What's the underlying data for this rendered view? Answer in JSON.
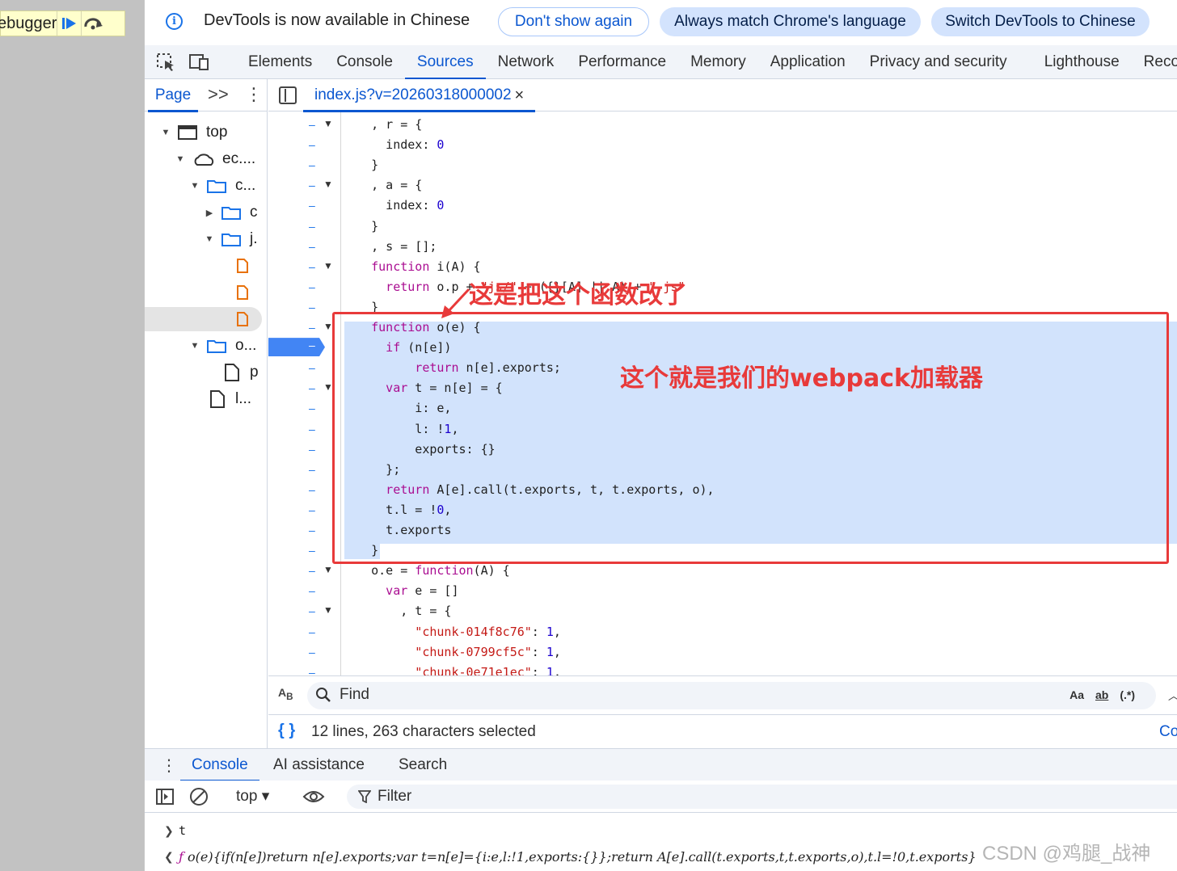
{
  "paused": {
    "label": "ebugger"
  },
  "infobar": {
    "message": "DevTools is now available in Chinese",
    "dont_show": "Don't show again",
    "always_match": "Always match Chrome's language",
    "switch": "Switch DevTools to Chinese"
  },
  "main_tabs": [
    "Elements",
    "Console",
    "Sources",
    "Network",
    "Performance",
    "Memory",
    "Application",
    "Privacy and security",
    "Lighthouse",
    "Reco"
  ],
  "active_main_tab": "Sources",
  "navigator": {
    "page_tab": "Page",
    "more": ">>",
    "tree": [
      "top",
      "ec....",
      "c...",
      "c",
      "j.",
      "o...",
      "p",
      "l..."
    ]
  },
  "editor": {
    "file_tab": "index.js?v=20260318000002",
    "close": "×"
  },
  "code_lines": [
    ", r = {",
    "index: 0",
    "}",
    ", a = {",
    "index: 0",
    "}",
    ", s = [];",
    "function i(A) {",
    "return o.p + \"js/\" + ({}[A] || A) + \".js\"",
    "}",
    "function o(e) {",
    "if (n[e])",
    "return n[e].exports;",
    "var t = n[e] = {",
    "i: e,",
    "l: !1,",
    "exports: {}",
    "};",
    "return A[e].call(t.exports, t, t.exports, o),",
    "t.l = !0,",
    "t.exports",
    "}",
    "o.e = function(A) {",
    "var e = []",
    ", t = {",
    "\"chunk-014f8c76\": 1,",
    "\"chunk-0799cf5c\": 1,",
    "\"chunk-0e71e1ec\": 1,"
  ],
  "annotations": {
    "arrow_note": "这是把这个函数改了",
    "box_note": "这个就是我们的webpack加载器"
  },
  "find": {
    "label": "Find",
    "opt_case": "Aa",
    "opt_word": "ab",
    "opt_regex": "(.*)"
  },
  "status": {
    "selection": "12 lines, 263 characters selected",
    "coverage": "Co"
  },
  "drawer": {
    "tabs": [
      "Console",
      "AI assistance",
      "Search"
    ],
    "context": "top ▾",
    "filter": "Filter"
  },
  "console": {
    "input": "t",
    "result": "o(e){if(n[e])return n[e].exports;var t=n[e]={i:e,l:!1,exports:{}};return A[e].call(t.exports,t,t.exports,o),t.l=!0,t.exports}",
    "result_keyword": "ƒ"
  },
  "watermark": "CSDN @鸡腿_战神",
  "colors": {
    "accent": "#0b57d0",
    "annotation": "#e83a3a",
    "selection": "#d2e3fc",
    "breakpoint": "#4285f4"
  }
}
